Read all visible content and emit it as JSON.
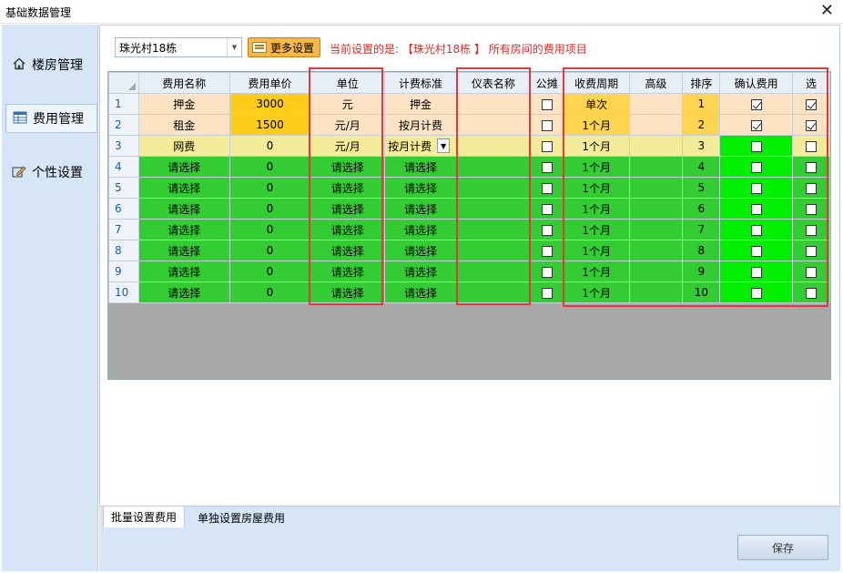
{
  "window": {
    "title": "基础数据管理"
  },
  "sidebar": {
    "items": [
      {
        "label": "楼房管理",
        "icon": "home-icon"
      },
      {
        "label": "费用管理",
        "icon": "table-icon"
      },
      {
        "label": "个性设置",
        "icon": "edit-icon"
      }
    ],
    "active_index": 1
  },
  "toolbar": {
    "building_value": "珠光村18栋",
    "more_settings_label": "更多设置",
    "info_text": "当前设置的是: 【珠光村18栋 】 所有房间的费用项目"
  },
  "grid": {
    "columns": [
      "费用名称",
      "费用单价",
      "单位",
      "计费标准",
      "仪表名称",
      "公摊",
      "收费周期",
      "高级",
      "排序",
      "确认费用",
      "选"
    ],
    "rows": [
      {
        "num": "1",
        "name": "押金",
        "price": "3000",
        "unit": "元",
        "standard": "押金",
        "meter": "",
        "shared": false,
        "cycle": "单次",
        "advanced": "",
        "order": "1",
        "confirm": true,
        "select": true
      },
      {
        "num": "2",
        "name": "租金",
        "price": "1500",
        "unit": "元/月",
        "standard": "按月计费",
        "meter": "",
        "shared": false,
        "cycle": "1个月",
        "advanced": "",
        "order": "2",
        "confirm": true,
        "select": true
      },
      {
        "num": "3",
        "name": "网费",
        "price": "0",
        "unit": "元/月",
        "standard": "按月计费",
        "meter": "",
        "shared": false,
        "cycle": "1个月",
        "advanced": "",
        "order": "3",
        "confirm": false,
        "select": false
      },
      {
        "num": "4",
        "name": "请选择",
        "price": "0",
        "unit": "请选择",
        "standard": "请选择",
        "meter": "",
        "shared": false,
        "cycle": "1个月",
        "advanced": "",
        "order": "4",
        "confirm": false,
        "select": false
      },
      {
        "num": "5",
        "name": "请选择",
        "price": "0",
        "unit": "请选择",
        "standard": "请选择",
        "meter": "",
        "shared": false,
        "cycle": "1个月",
        "advanced": "",
        "order": "5",
        "confirm": false,
        "select": false
      },
      {
        "num": "6",
        "name": "请选择",
        "price": "0",
        "unit": "请选择",
        "standard": "请选择",
        "meter": "",
        "shared": false,
        "cycle": "1个月",
        "advanced": "",
        "order": "6",
        "confirm": false,
        "select": false
      },
      {
        "num": "7",
        "name": "请选择",
        "price": "0",
        "unit": "请选择",
        "standard": "请选择",
        "meter": "",
        "shared": false,
        "cycle": "1个月",
        "advanced": "",
        "order": "7",
        "confirm": false,
        "select": false
      },
      {
        "num": "8",
        "name": "请选择",
        "price": "0",
        "unit": "请选择",
        "standard": "请选择",
        "meter": "",
        "shared": false,
        "cycle": "1个月",
        "advanced": "",
        "order": "8",
        "confirm": false,
        "select": false
      },
      {
        "num": "9",
        "name": "请选择",
        "price": "0",
        "unit": "请选择",
        "standard": "请选择",
        "meter": "",
        "shared": false,
        "cycle": "1个月",
        "advanced": "",
        "order": "9",
        "confirm": false,
        "select": false
      },
      {
        "num": "10",
        "name": "请选择",
        "price": "0",
        "unit": "请选择",
        "standard": "请选择",
        "meter": "",
        "shared": false,
        "cycle": "1个月",
        "advanced": "",
        "order": "10",
        "confirm": false,
        "select": false
      }
    ],
    "current_row": 3
  },
  "tabs": [
    {
      "label": "批量设置费用"
    },
    {
      "label": "单独设置房屋费用"
    }
  ],
  "actions": {
    "save_label": "保存"
  },
  "colors": {
    "highlight_box": "#e03a3a",
    "row_peach": "#fde3c4",
    "row_green": "#33cc33",
    "price_gold": "#ffcc1a",
    "confirm_lime": "#00ee00"
  }
}
